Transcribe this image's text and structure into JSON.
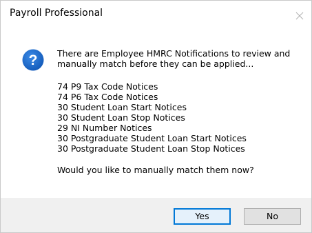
{
  "window": {
    "title": "Payroll Professional"
  },
  "dialog": {
    "icon": "info-question-icon",
    "intro": "There are Employee HMRC Notifications to review and manually match before they can be applied...",
    "notices": [
      "74 P9 Tax Code Notices",
      "74 P6 Tax Code Notices",
      "30 Student Loan Start Notices",
      "30 Student Loan Stop Notices",
      "29 NI Number Notices",
      "30 Postgraduate Student Loan Start Notices",
      "30 Postgraduate Student Loan Stop Notices"
    ],
    "question": "Would you like to manually match them now?"
  },
  "buttons": {
    "yes_label": "Yes",
    "no_label": "No"
  },
  "colors": {
    "icon_blue": "#1c6dd0",
    "default_button_border": "#0078d7",
    "footer_bg": "#f0f0f0"
  }
}
